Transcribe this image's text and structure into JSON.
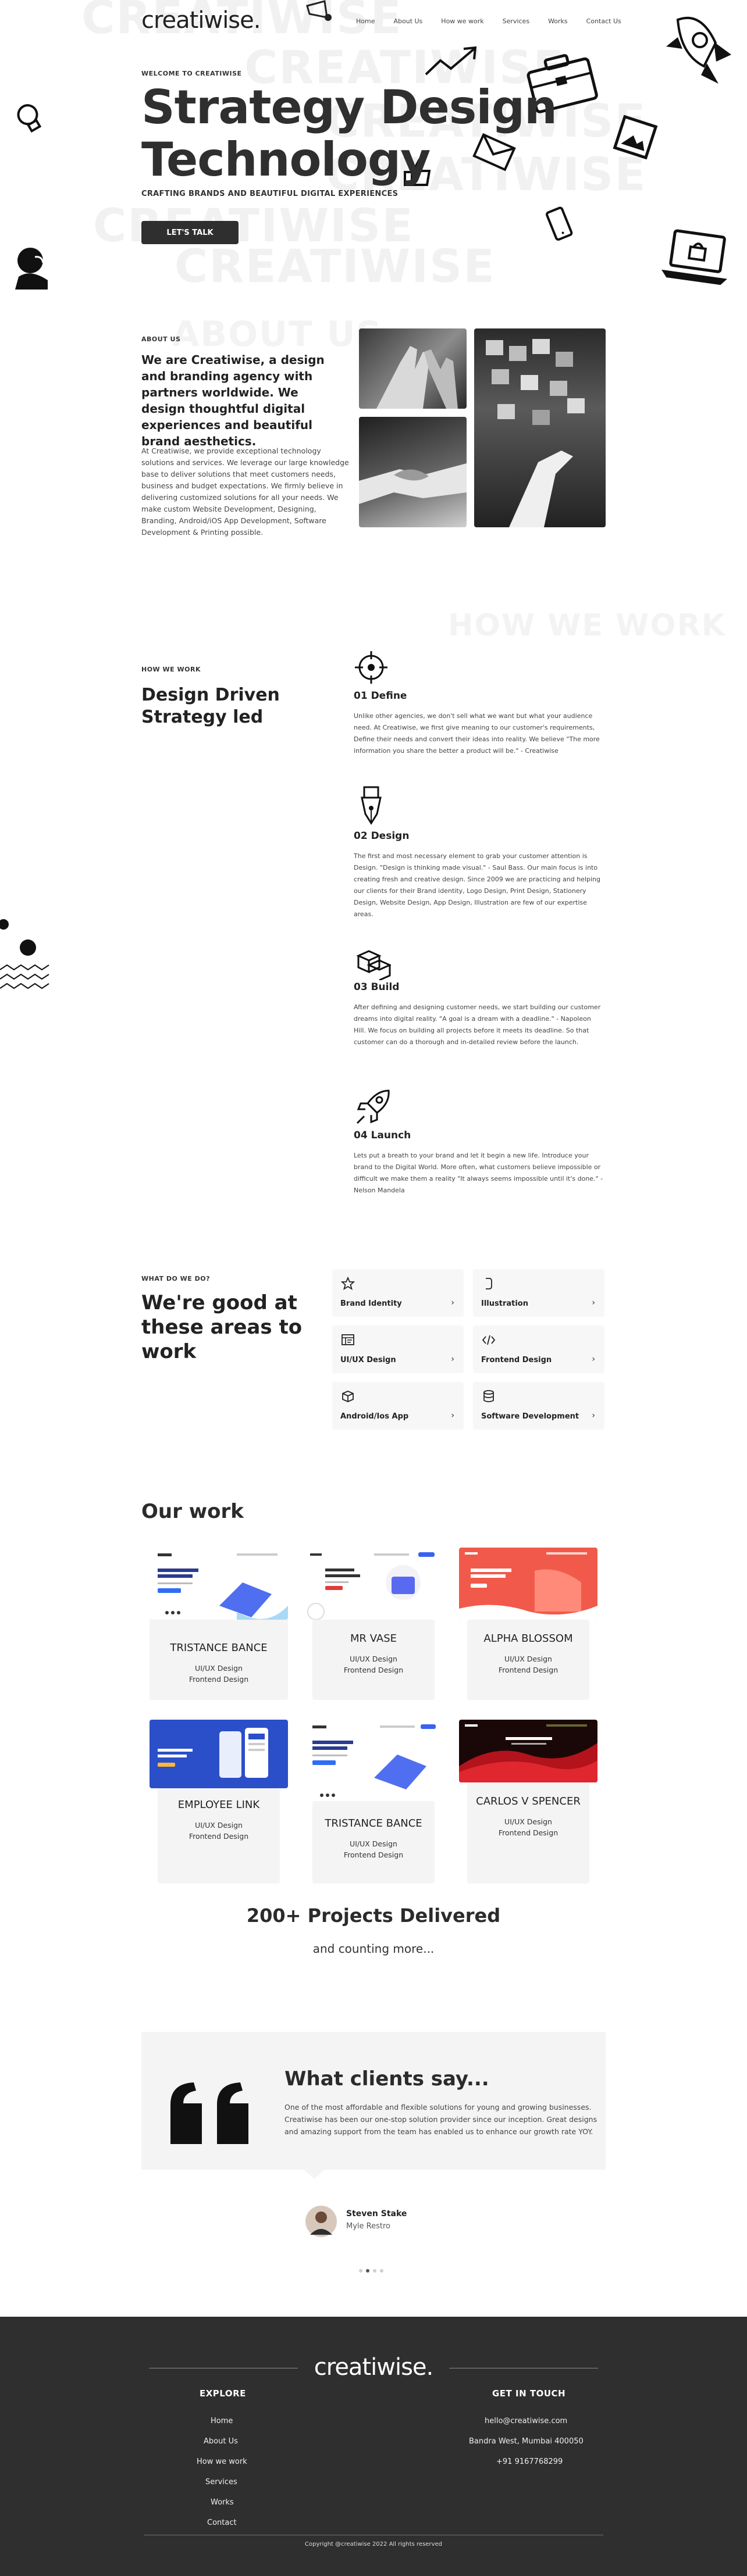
{
  "brand": {
    "logo": "creatiwise."
  },
  "nav": {
    "items": [
      "Home",
      "About Us",
      "How we work",
      "Services",
      "Works",
      "Contact Us"
    ]
  },
  "hero": {
    "eyebrow": "WELCOME TO CREATIWISE",
    "title_line1": "Strategy Design",
    "title_line2": "Technology",
    "subtitle": "CRAFTING BRANDS AND BEAUTIFUL DIGITAL EXPERIENCES",
    "cta": "LET'S TALK",
    "bg_text": "CREATIWISE"
  },
  "about": {
    "eyebrow": "ABOUT US",
    "bg_text": "ABOUT US",
    "headline": "We are Creatiwise, a design and branding agency with partners worldwide. We design thoughtful digital experiences and beautiful brand aesthetics.",
    "body": "At Creatiwise, we provide exceptional technology solutions and services. We leverage our large knowledge base to deliver solutions that meet customers needs, business and budget expectations. We firmly believe in delivering customized solutions for all your needs. We make custom Website Development, Designing, Branding, Android/iOS App Development, Software Development & Printing possible."
  },
  "how_we_work": {
    "eyebrow": "HOW WE WORK",
    "bg_text": "HOW WE WORK",
    "title": "Design Driven Strategy led",
    "steps": [
      {
        "title": "01 Define",
        "icon": "target-icon",
        "body": "Unlike other agencies, we don't sell what we want but what your audience need. At Creatiwise, we first give meaning to our customer's requirements, Define their needs and convert their ideas into reality. We believe \"The more information you share the better a product will be.\" - Creatiwise"
      },
      {
        "title": "02 Design",
        "icon": "pen-nib-icon",
        "body": "The first and most necessary element to grab your customer attention is Design. \"Design is thinking made visual.\" - Saul Bass. Our main focus is into creating fresh and creative design. Since 2009 we are practicing and helping our clients for their Brand identity, Logo Design, Print Design, Stationery Design, Website Design, App Design, Illustration are few of our expertise areas."
      },
      {
        "title": "03 Build",
        "icon": "cubes-icon",
        "body": "After defining and designing customer needs, we start building our customer dreams into digital reality. \"A goal is a dream with a deadline.\" - Napoleon Hill. We focus on building all projects before it meets its deadline. So that customer can do a thorough and in-detailed review before the launch."
      },
      {
        "title": "04 Launch",
        "icon": "rocket-icon",
        "body": "Lets put a breath to your brand and let it begin a new life. Introduce your brand to the Digital World. More often, what customers believe impossible or difficult we make them a reality \"It always seems impossible until it's done.\" - Nelson Mandela"
      }
    ]
  },
  "services": {
    "eyebrow": "WHAT DO WE DO?",
    "title": "We're good at these areas to work",
    "items": [
      {
        "label": "Brand Identity",
        "icon": "star-icon"
      },
      {
        "label": "Illustration",
        "icon": "bracket-icon"
      },
      {
        "label": "UI/UX Design",
        "icon": "layout-icon"
      },
      {
        "label": "Frontend Design",
        "icon": "code-icon"
      },
      {
        "label": "Android/Ios App",
        "icon": "box-icon"
      },
      {
        "label": "Software Development",
        "icon": "database-icon"
      }
    ],
    "arrow": "›"
  },
  "work": {
    "title": "Our work",
    "projects": [
      {
        "name": "TRISTANCE BANCE",
        "tags": [
          "UI/UX Design",
          "Frontend Design"
        ]
      },
      {
        "name": "MR VASE",
        "tags": [
          "UI/UX Design",
          "Frontend Design"
        ]
      },
      {
        "name": "ALPHA BLOSSOM",
        "tags": [
          "UI/UX Design",
          "Frontend Design"
        ]
      },
      {
        "name": "EMPLOYEE LINK",
        "tags": [
          "UI/UX Design",
          "Frontend Design"
        ]
      },
      {
        "name": "TRISTANCE BANCE",
        "tags": [
          "UI/UX Design",
          "Frontend Design"
        ]
      },
      {
        "name": "CARLOS V SPENCER",
        "tags": [
          "UI/UX Design",
          "Frontend Design"
        ]
      }
    ],
    "delivered": "200+ Projects Delivered",
    "counting": "and counting more..."
  },
  "testimonial": {
    "title": "What clients say...",
    "text": "One of the most affordable and flexible solutions for young and growing businesses. Creatiwise has been our one-stop solution provider since our inception. Great designs and amazing support from the team has enabled us to enhance our growth rate YOY.",
    "author": "Steven Stake",
    "company": "Myle Restro"
  },
  "footer": {
    "logo": "creatiwise.",
    "explore_head": "EXPLORE",
    "explore_links": [
      "Home",
      "About Us",
      "How we work",
      "Services",
      "Works",
      "Contact"
    ],
    "touch_head": "GET IN TOUCH",
    "email": "hello@creatiwise.com",
    "address": "Bandra West, Mumbai 400050",
    "phone": "+91 9167768299",
    "copyright": "Copyright @creatiwise 2022 All rights reserved"
  },
  "colors": {
    "dark": "#2f2f2f",
    "card": "#f4f4f4",
    "text": "#2b2b2b"
  }
}
